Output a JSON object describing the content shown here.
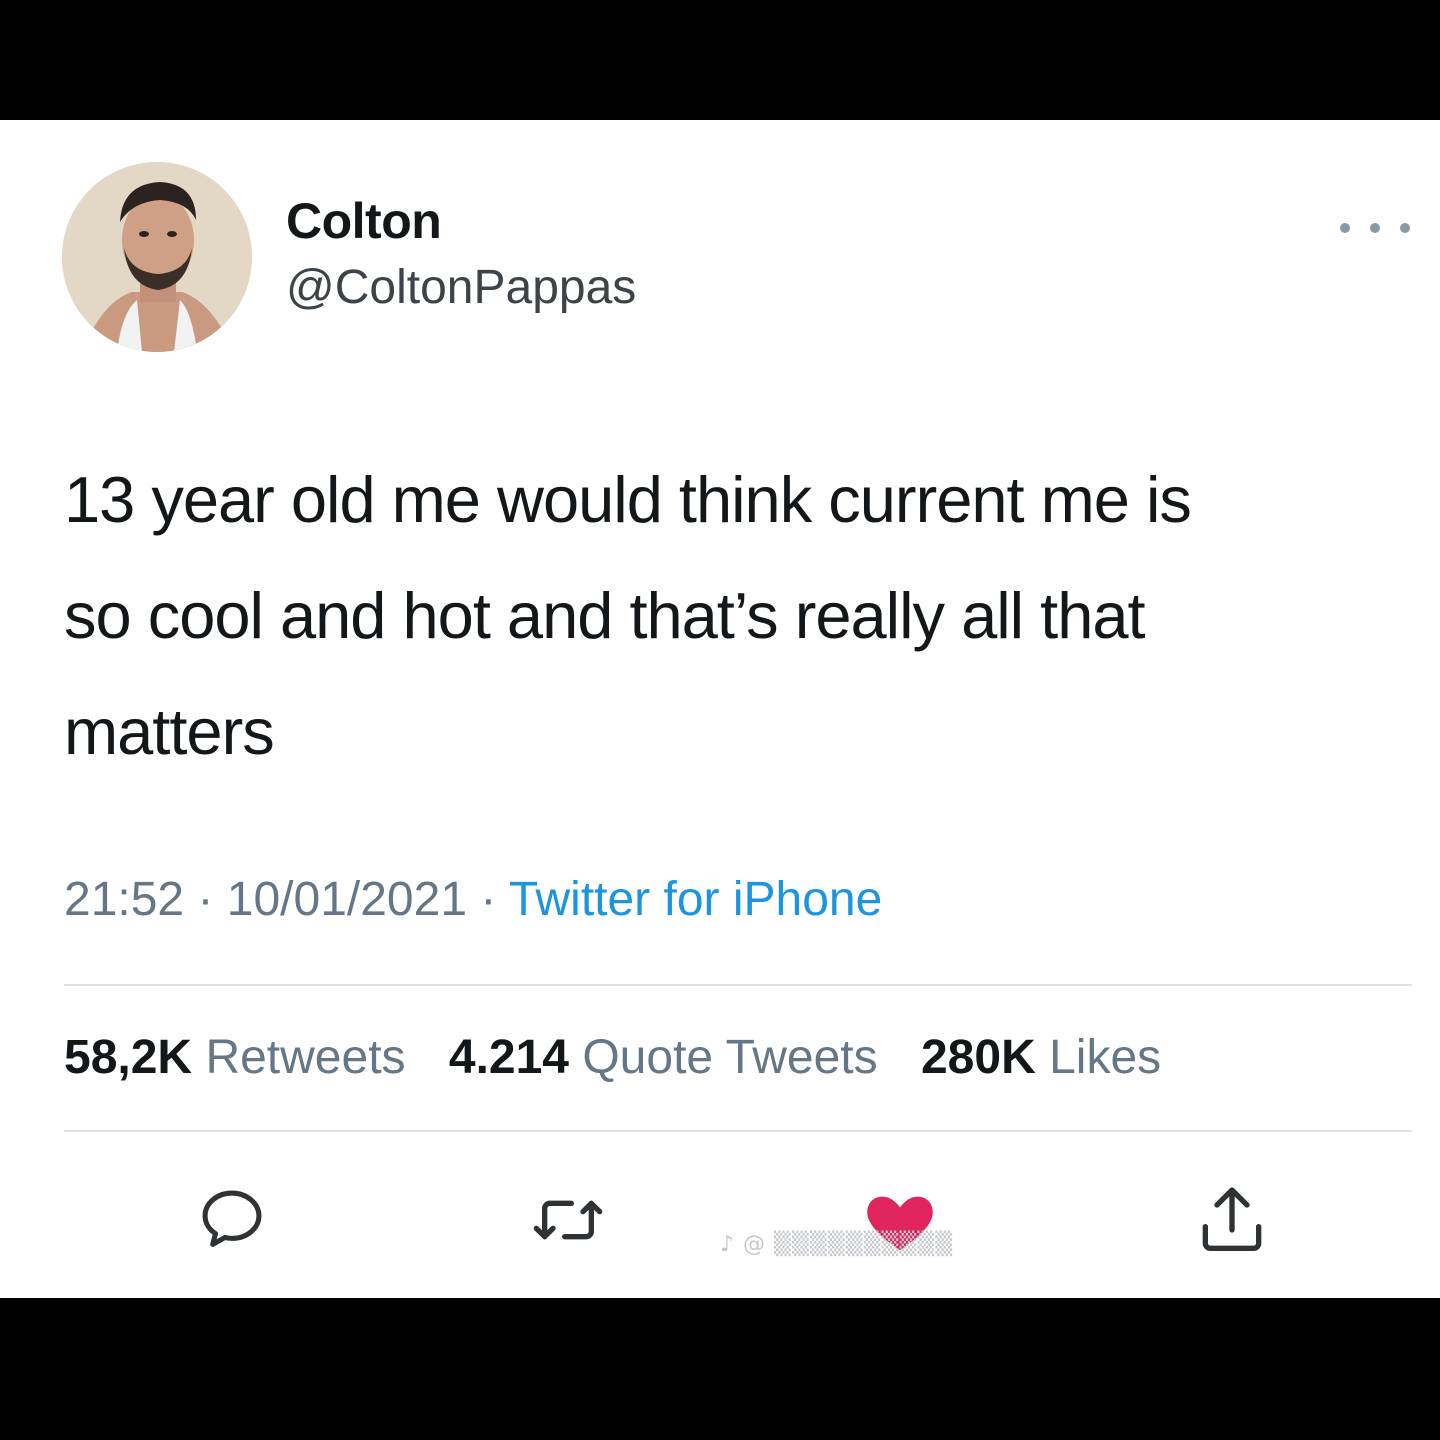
{
  "tweet": {
    "author": {
      "display_name": "Colton",
      "handle": "@ColtonPappas"
    },
    "text": "13 year old me would think current me is\nso cool and hot and that’s really all that\nmatters",
    "meta": {
      "time": "21:52",
      "separator": " · ",
      "date": "10/01/2021",
      "source": "Twitter for iPhone"
    },
    "stats": [
      {
        "value": "58,2K",
        "label": "Retweets"
      },
      {
        "value": "4.214",
        "label": "Quote Tweets"
      },
      {
        "value": "280K",
        "label": "Likes"
      }
    ],
    "actions": {
      "reply_icon": "reply-icon",
      "retweet_icon": "retweet-icon",
      "like_icon": "heart-icon",
      "like_color": "#e0245e",
      "share_icon": "share-icon"
    }
  },
  "colors": {
    "accent": "#1c94e0",
    "text_primary": "#14171a",
    "text_secondary": "#657786",
    "background": "#ffffff",
    "frame": "#000000"
  }
}
